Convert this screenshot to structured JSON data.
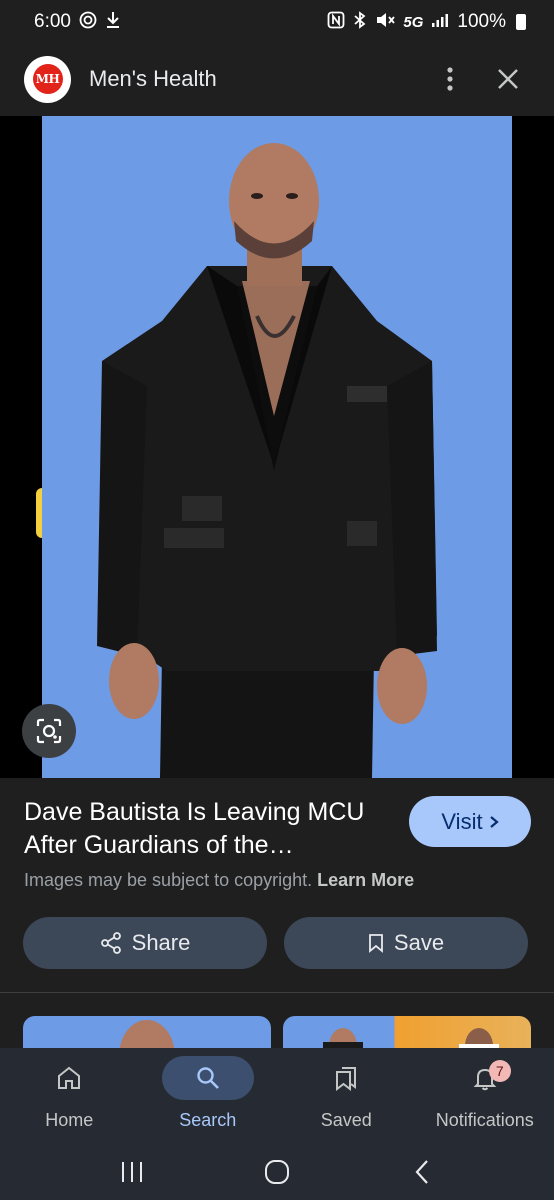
{
  "status_bar": {
    "time": "6:00",
    "network": "5G",
    "battery": "100%"
  },
  "header": {
    "site_logo_text": "MH",
    "site_name": "Men's Health"
  },
  "result": {
    "title": "Dave Bautista Is Leaving MCU After Guardians of the…",
    "visit_label": "Visit",
    "copyright_text": "Images may be subject to copyright.",
    "learn_more": "Learn More",
    "share_label": "Share",
    "save_label": "Save"
  },
  "bottom_nav": {
    "items": [
      {
        "label": "Home",
        "icon": "home-icon",
        "active": false
      },
      {
        "label": "Search",
        "icon": "search-icon",
        "active": true
      },
      {
        "label": "Saved",
        "icon": "saved-icon",
        "active": false
      },
      {
        "label": "Notifications",
        "icon": "bell-icon",
        "active": false,
        "badge": "7"
      }
    ]
  },
  "colors": {
    "background": "#1f1f1f",
    "accent": "#a8c7fa",
    "button_bg": "#3c4758",
    "photo_backdrop": "#6d9be6",
    "badge": "#f2b8b5"
  }
}
